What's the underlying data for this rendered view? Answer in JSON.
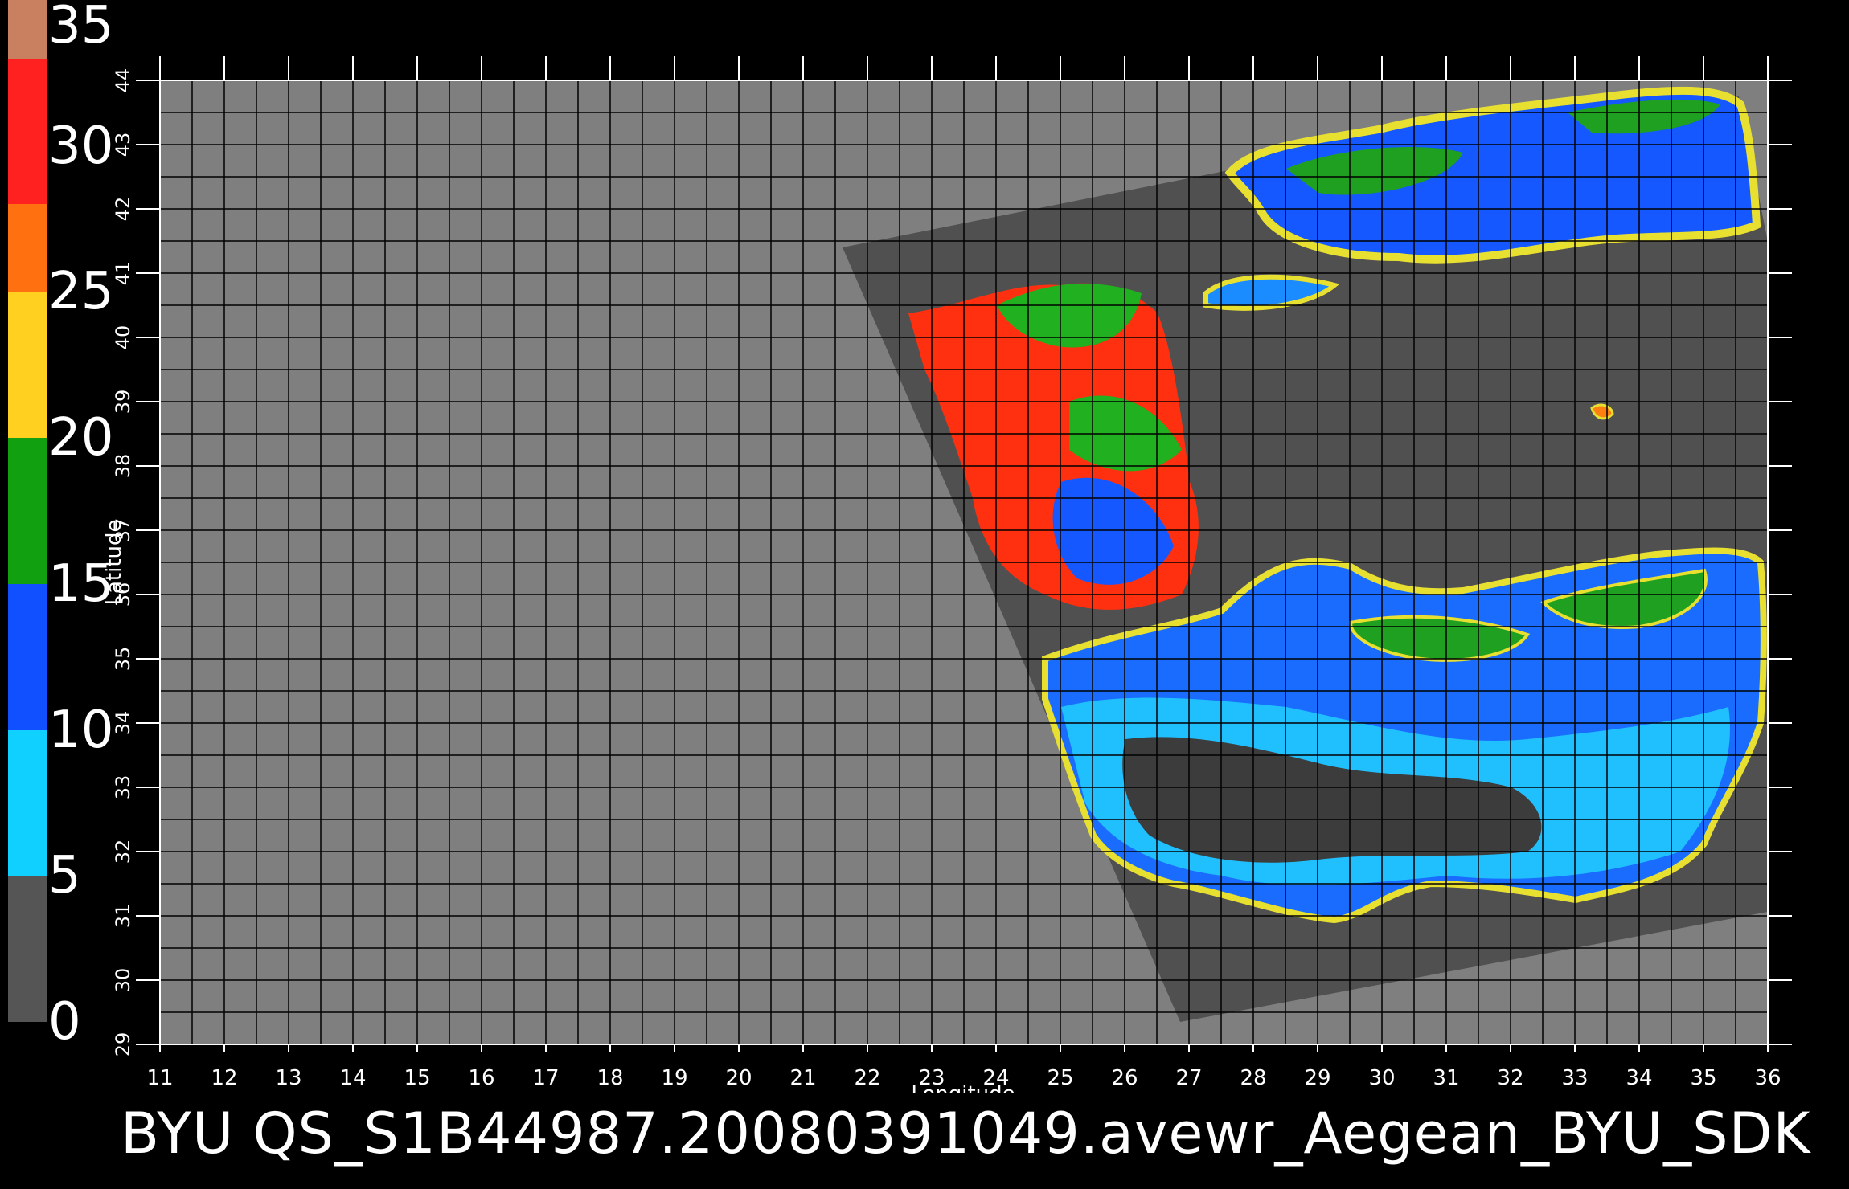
{
  "colorbar": {
    "labels": [
      "35",
      "30",
      "25",
      "20",
      "15",
      "10",
      "5",
      "0"
    ],
    "bands": [
      {
        "from": 33,
        "to": 35,
        "color": "#c88060"
      },
      {
        "from": 28,
        "to": 33,
        "color": "#ff2020"
      },
      {
        "from": 25,
        "to": 28,
        "color": "#ff7010"
      },
      {
        "from": 20,
        "to": 25,
        "color": "#ffd020"
      },
      {
        "from": 15,
        "to": 20,
        "color": "#10a010"
      },
      {
        "from": 10,
        "to": 15,
        "color": "#1050ff"
      },
      {
        "from": 5,
        "to": 10,
        "color": "#10d0ff"
      },
      {
        "from": 0,
        "to": 5,
        "color": "#555555"
      }
    ]
  },
  "map": {
    "xlabel": "Longitude",
    "ylabel": "Latitude",
    "lon_ticks": [
      "11",
      "12",
      "13",
      "14",
      "15",
      "16",
      "17",
      "18",
      "19",
      "20",
      "21",
      "22",
      "23",
      "24",
      "25",
      "26",
      "27",
      "28",
      "29",
      "30",
      "31",
      "32",
      "33",
      "34",
      "35",
      "36"
    ],
    "lat_ticks": [
      "29",
      "30",
      "31",
      "32",
      "33",
      "34",
      "35",
      "36",
      "37",
      "38",
      "39",
      "40",
      "41",
      "42",
      "43",
      "44"
    ],
    "lon_range": [
      11,
      36
    ],
    "lat_range": [
      29,
      44
    ],
    "background_color": "#7f7f7f",
    "swath_color": "#505050",
    "grid": true
  },
  "caption": "BYU  QS_S1B44987.20080391049.avewr_Aegean_BYU_SDK"
}
